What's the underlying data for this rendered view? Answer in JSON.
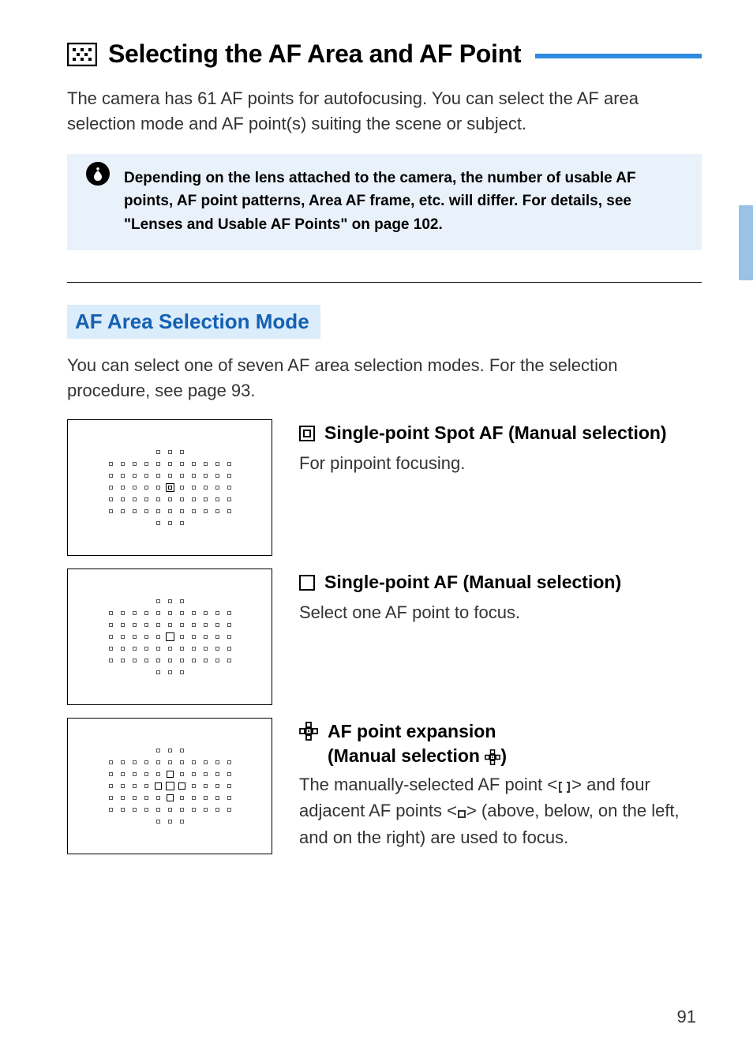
{
  "title": "Selecting the AF Area and AF Point",
  "intro": "The camera has 61 AF points for autofocusing. You can select the AF area selection mode and AF point(s) suiting the scene or subject.",
  "note": "Depending on the lens attached to the camera, the number of usable AF points, AF point patterns, Area AF frame, etc. will differ. For details, see \"Lenses and Usable AF Points\" on page 102.",
  "section_heading": "AF Area Selection Mode",
  "section_intro": "You can select one of seven AF area selection modes. For the selection procedure, see page 93.",
  "modes": {
    "spot": {
      "title": "Single-point Spot AF (Manual selection)",
      "desc": "For pinpoint focusing."
    },
    "single": {
      "title": "Single-point AF (Manual selection)",
      "desc": "Select one AF point to focus."
    },
    "expand": {
      "title_line1": "AF point expansion",
      "title_line2_prefix": "(Manual selection ",
      "title_line2_suffix": ")",
      "desc_a": "The manually-selected AF point <",
      "desc_b": "> and four adjacent AF points <",
      "desc_c": "> (above, below, on the left, and on the right) are used to focus."
    }
  },
  "page_number": "91"
}
